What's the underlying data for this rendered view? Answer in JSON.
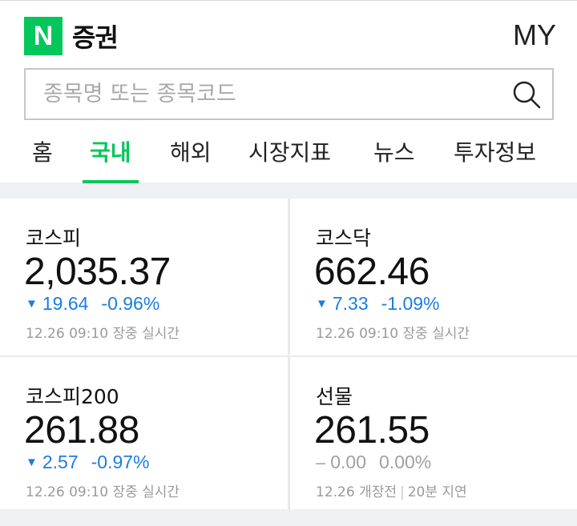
{
  "header": {
    "logo_letter": "N",
    "service_name": "증권",
    "my_label": "MY"
  },
  "search": {
    "placeholder": "종목명 또는 종목코드",
    "value": ""
  },
  "tabs": [
    {
      "label": "홈",
      "active": false
    },
    {
      "label": "국내",
      "active": true
    },
    {
      "label": "해외",
      "active": false
    },
    {
      "label": "시장지표",
      "active": false
    },
    {
      "label": "뉴스",
      "active": false
    },
    {
      "label": "투자정보",
      "active": false
    }
  ],
  "indices": [
    {
      "name": "코스피",
      "value": "2,035.37",
      "direction": "down",
      "change": "19.64",
      "percent": "-0.96%",
      "time": "12.26 09:10",
      "status": "장중 실시간"
    },
    {
      "name": "코스닥",
      "value": "662.46",
      "direction": "down",
      "change": "7.33",
      "percent": "-1.09%",
      "time": "12.26 09:10",
      "status": "장중 실시간"
    },
    {
      "name": "코스피200",
      "value": "261.88",
      "direction": "down",
      "change": "2.57",
      "percent": "-0.97%",
      "time": "12.26 09:10",
      "status": "장중 실시간"
    },
    {
      "name": "선물",
      "value": "261.55",
      "direction": "flat",
      "change": "0.00",
      "percent": "0.00%",
      "time": "12.26",
      "status": "개장전",
      "status2": "20분 지연"
    }
  ],
  "colors": {
    "brand": "#03c75a",
    "down": "#1c7ce0",
    "flat": "#a0a0a0"
  },
  "icons": {
    "down": "triangle-down",
    "flat": "dash"
  }
}
